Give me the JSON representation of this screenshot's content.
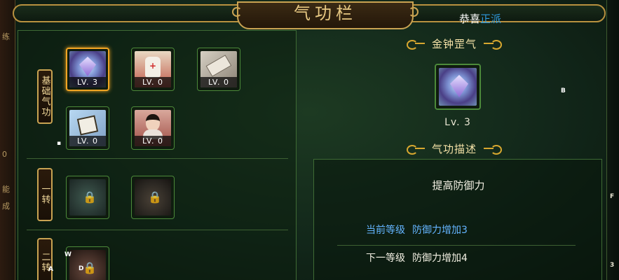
{
  "header": {
    "title": "气功栏",
    "congrats_prefix": "恭喜",
    "congrats_faction": "正派"
  },
  "sections": [
    {
      "label": "基础气功",
      "skills": [
        {
          "name": "金钟罡气",
          "icon": "purple-diamond-icon",
          "level": "LV. 3",
          "selected": true,
          "locked": false
        },
        {
          "name": "",
          "icon": "medicine-bottle-icon",
          "level": "LV. 0",
          "selected": false,
          "locked": false
        },
        {
          "name": "",
          "icon": "scroll-icon",
          "level": "LV. 0",
          "selected": false,
          "locked": false
        },
        {
          "name": "",
          "icon": "box-icon",
          "level": "LV. 0",
          "selected": false,
          "locked": false
        },
        {
          "name": "",
          "icon": "swordsman-portrait-icon",
          "level": "LV. 0",
          "selected": false,
          "locked": false
        }
      ]
    },
    {
      "label": "一转",
      "skills": [
        {
          "icon": "lock-icon",
          "locked": true
        },
        {
          "icon": "lock-icon",
          "locked": true
        }
      ]
    },
    {
      "label": "二转",
      "skills": [
        {
          "icon": "lock-icon",
          "locked": true
        }
      ]
    }
  ],
  "detail": {
    "skill_name": "金钟罡气",
    "level": "Lv. 3",
    "desc_heading": "气功描述",
    "description": "提高防御力",
    "current_label": "当前等级",
    "current_effect": "防御力增加3",
    "next_label": "下一等级",
    "next_effect": "防御力增加4"
  },
  "stray_glyphs": {
    "b": "B",
    "w": "W",
    "a": "A",
    "d": "D",
    "f": "F",
    "three": "3",
    "dot": "▪"
  },
  "left_strip_glyphs": [
    "练",
    "",
    "0",
    "能",
    "成"
  ],
  "colors": {
    "accent_gold": "#c9a352",
    "selected_border": "#f1a523",
    "faction_blue": "#2f9be0",
    "current_level_blue": "#64b4ff"
  }
}
